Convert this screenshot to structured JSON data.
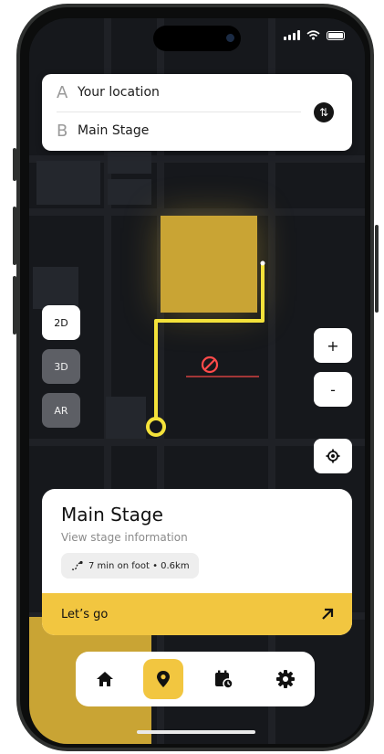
{
  "route": {
    "origin_letter": "A",
    "origin": "Your location",
    "destination_letter": "B",
    "destination": "Main Stage",
    "swap_icon": "swap-vertical-icon"
  },
  "map_modes": [
    {
      "label": "2D",
      "active": true
    },
    {
      "label": "3D",
      "active": false
    },
    {
      "label": "AR",
      "active": false
    }
  ],
  "zoom": {
    "in_label": "+",
    "out_label": "-"
  },
  "destination_card": {
    "title": "Main Stage",
    "subtitle": "View stage information",
    "walk_info": "7 min on foot • 0.6km",
    "action_label": "Let’s go"
  },
  "tabs": [
    {
      "name": "home",
      "icon": "home-icon",
      "active": false
    },
    {
      "name": "map",
      "icon": "map-pin-icon",
      "active": true
    },
    {
      "name": "schedule",
      "icon": "calendar-clock-icon",
      "active": false
    },
    {
      "name": "settings",
      "icon": "gear-icon",
      "active": false
    }
  ],
  "colors": {
    "accent": "#f2c640",
    "venue": "#c9a434",
    "route_line": "#f4e23a",
    "blocked": "#ff4a4a",
    "map_background": "#16181c"
  }
}
